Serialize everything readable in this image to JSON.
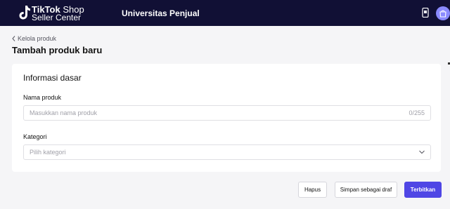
{
  "header": {
    "brand_line1_bold": "TikTok",
    "brand_line1_rest": " Shop",
    "brand_line2": "Seller Center",
    "nav_link": "Universitas Penjual"
  },
  "breadcrumb": {
    "label": "Kelola produk"
  },
  "page": {
    "title": "Tambah produk baru"
  },
  "section": {
    "title": "Informasi dasar",
    "name_field": {
      "label": "Nama produk",
      "placeholder": "Masukkan nama produk",
      "value": "",
      "counter": "0/255"
    },
    "category_field": {
      "label": "Kategori",
      "placeholder": "Pilih kategori"
    }
  },
  "actions": {
    "delete": "Hapus",
    "save_draft": "Simpan sebagai draf",
    "publish": "Terbitkan"
  },
  "colors": {
    "header_bg": "#111035",
    "primary": "#4f46e5",
    "page_bg": "#f5f5f7"
  },
  "icons": {
    "logo": "tiktok-note-icon",
    "top_right_1": "phone-icon",
    "top_right_2": "shop-avatar-icon",
    "breadcrumb": "chevron-left-icon",
    "select": "chevron-down-icon"
  }
}
